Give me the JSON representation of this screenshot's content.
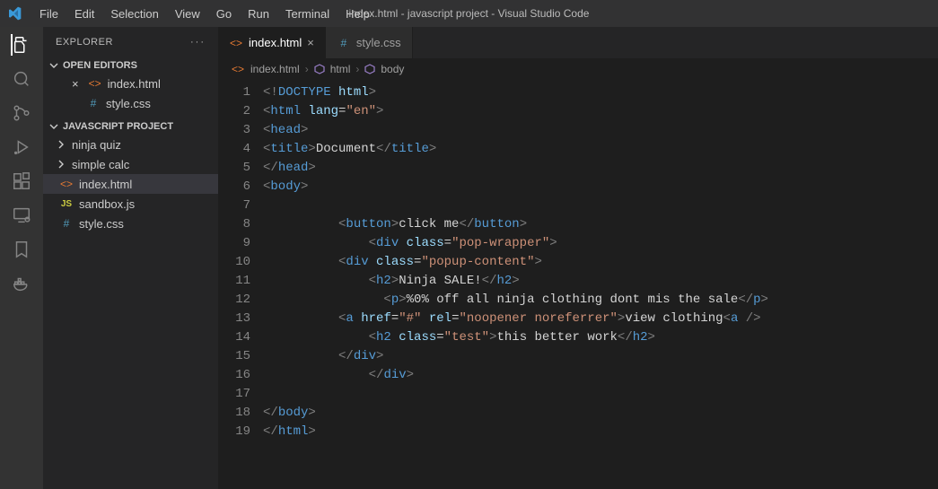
{
  "titlebar": {
    "title": "index.html - javascript project - Visual Studio Code",
    "menu": [
      "File",
      "Edit",
      "Selection",
      "View",
      "Go",
      "Run",
      "Terminal",
      "Help"
    ]
  },
  "sidebar": {
    "title": "EXPLORER",
    "sections": {
      "openEditors": {
        "label": "OPEN EDITORS",
        "items": [
          {
            "name": "index.html",
            "icon": "html",
            "modified": false,
            "closeable": true
          },
          {
            "name": "style.css",
            "icon": "css",
            "modified": false,
            "closeable": false
          }
        ]
      },
      "project": {
        "label": "JAVASCRIPT PROJECT",
        "items": [
          {
            "name": "ninja quiz",
            "type": "folder"
          },
          {
            "name": "simple calc",
            "type": "folder"
          },
          {
            "name": "index.html",
            "type": "file",
            "icon": "html",
            "selected": true
          },
          {
            "name": "sandbox.js",
            "type": "file",
            "icon": "js"
          },
          {
            "name": "style.css",
            "type": "file",
            "icon": "css"
          }
        ]
      }
    }
  },
  "tabs": [
    {
      "name": "index.html",
      "icon": "html",
      "active": true,
      "close": "×"
    },
    {
      "name": "style.css",
      "icon": "css",
      "active": false,
      "close": ""
    }
  ],
  "breadcrumb": [
    "index.html",
    "html",
    "body"
  ],
  "code": {
    "lines": [
      [
        [
          "b",
          "<!"
        ],
        [
          "d",
          "DOCTYPE "
        ],
        [
          "a",
          "html"
        ],
        [
          "b",
          ">"
        ]
      ],
      [
        [
          "b",
          "<"
        ],
        [
          "t",
          "html "
        ],
        [
          "a",
          "lang"
        ],
        [
          "x",
          "="
        ],
        [
          "s",
          "\"en\""
        ],
        [
          "b",
          ">"
        ]
      ],
      [
        [
          "b",
          "<"
        ],
        [
          "t",
          "head"
        ],
        [
          "b",
          ">"
        ]
      ],
      [
        [
          "b",
          "<"
        ],
        [
          "t",
          "title"
        ],
        [
          "b",
          ">"
        ],
        [
          "x",
          "Document"
        ],
        [
          "b",
          "</"
        ],
        [
          "t",
          "title"
        ],
        [
          "b",
          ">"
        ]
      ],
      [
        [
          "b",
          "</"
        ],
        [
          "t",
          "head"
        ],
        [
          "b",
          ">"
        ]
      ],
      [
        [
          "b",
          "<"
        ],
        [
          "t",
          "body"
        ],
        [
          "b",
          ">"
        ]
      ],
      [],
      [
        [
          "x",
          "          "
        ],
        [
          "b",
          "<"
        ],
        [
          "t",
          "button"
        ],
        [
          "b",
          ">"
        ],
        [
          "x",
          "click me"
        ],
        [
          "b",
          "</"
        ],
        [
          "t",
          "button"
        ],
        [
          "b",
          ">"
        ]
      ],
      [
        [
          "x",
          "              "
        ],
        [
          "b",
          "<"
        ],
        [
          "t",
          "div "
        ],
        [
          "a",
          "class"
        ],
        [
          "x",
          "="
        ],
        [
          "s",
          "\"pop-wrapper\""
        ],
        [
          "b",
          ">"
        ]
      ],
      [
        [
          "x",
          "          "
        ],
        [
          "b",
          "<"
        ],
        [
          "t",
          "div "
        ],
        [
          "a",
          "class"
        ],
        [
          "x",
          "="
        ],
        [
          "s",
          "\"popup-content\""
        ],
        [
          "b",
          ">"
        ]
      ],
      [
        [
          "x",
          "              "
        ],
        [
          "b",
          "<"
        ],
        [
          "t",
          "h2"
        ],
        [
          "b",
          ">"
        ],
        [
          "x",
          "Ninja SALE!"
        ],
        [
          "b",
          "</"
        ],
        [
          "t",
          "h2"
        ],
        [
          "b",
          ">"
        ]
      ],
      [
        [
          "x",
          "                "
        ],
        [
          "b",
          "<"
        ],
        [
          "t",
          "p"
        ],
        [
          "b",
          ">"
        ],
        [
          "x",
          "%0% off all ninja clothing dont mis the sale"
        ],
        [
          "b",
          "</"
        ],
        [
          "t",
          "p"
        ],
        [
          "b",
          ">"
        ]
      ],
      [
        [
          "x",
          "          "
        ],
        [
          "b",
          "<"
        ],
        [
          "t",
          "a "
        ],
        [
          "a",
          "href"
        ],
        [
          "x",
          "="
        ],
        [
          "s",
          "\"#\" "
        ],
        [
          "a",
          "rel"
        ],
        [
          "x",
          "="
        ],
        [
          "s",
          "\"noopener noreferrer\""
        ],
        [
          "b",
          ">"
        ],
        [
          "x",
          "view clothing"
        ],
        [
          "b",
          "<"
        ],
        [
          "t",
          "a "
        ],
        [
          "b",
          "/>"
        ]
      ],
      [
        [
          "x",
          "              "
        ],
        [
          "b",
          "<"
        ],
        [
          "t",
          "h2 "
        ],
        [
          "a",
          "class"
        ],
        [
          "x",
          "="
        ],
        [
          "s",
          "\"test\""
        ],
        [
          "b",
          ">"
        ],
        [
          "x",
          "this better work"
        ],
        [
          "b",
          "</"
        ],
        [
          "t",
          "h2"
        ],
        [
          "b",
          ">"
        ]
      ],
      [
        [
          "x",
          "          "
        ],
        [
          "b",
          "</"
        ],
        [
          "t",
          "div"
        ],
        [
          "b",
          ">"
        ]
      ],
      [
        [
          "x",
          "              "
        ],
        [
          "b",
          "</"
        ],
        [
          "t",
          "div"
        ],
        [
          "b",
          ">"
        ]
      ],
      [],
      [
        [
          "b",
          "</"
        ],
        [
          "t",
          "body"
        ],
        [
          "b",
          ">"
        ]
      ],
      [
        [
          "b",
          "</"
        ],
        [
          "t",
          "html"
        ],
        [
          "b",
          ">"
        ]
      ]
    ]
  }
}
